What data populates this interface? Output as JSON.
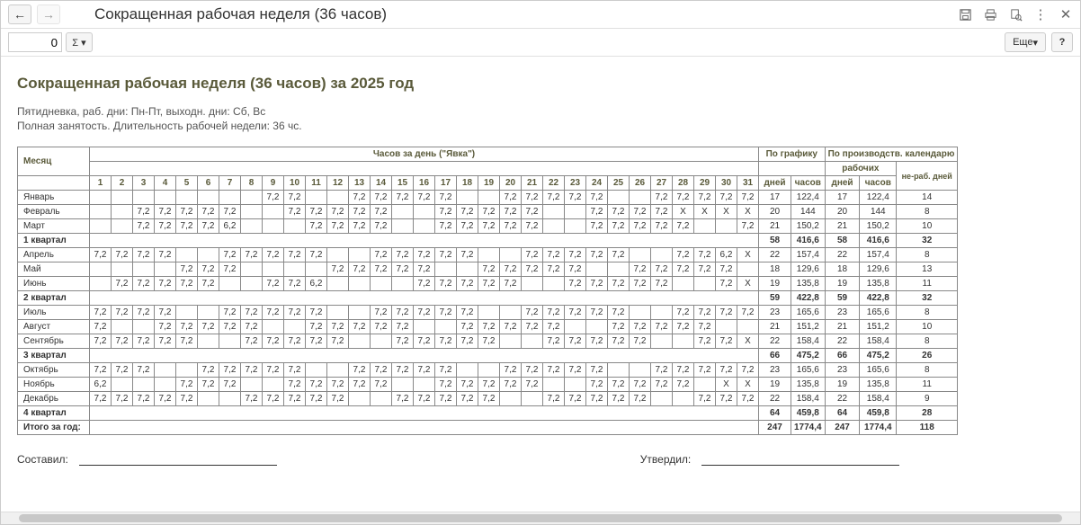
{
  "header": {
    "title": "Сокращенная рабочая неделя (36 часов)"
  },
  "toolbar": {
    "page_number": "0",
    "more_label": "Еще",
    "help_label": "?"
  },
  "report": {
    "title": "Сокращенная рабочая неделя (36 часов) за 2025 год",
    "line1": "Пятидневка, раб. дни: Пн-Пт, выходн. дни: Сб, Вс",
    "line2": "Полная занятость. Длительность рабочей недели: 36 чс."
  },
  "headers": {
    "month": "Месяц",
    "hours_per_day": "Часов за день (\"Явка\")",
    "by_schedule": "По графику",
    "by_calendar": "По производств. календарю",
    "work_short": "рабочих",
    "nonwork_short": "не-раб. дней",
    "days": "дней",
    "hours": "часов"
  },
  "day_nums": [
    "1",
    "2",
    "3",
    "4",
    "5",
    "6",
    "7",
    "8",
    "9",
    "10",
    "11",
    "12",
    "13",
    "14",
    "15",
    "16",
    "17",
    "18",
    "19",
    "20",
    "21",
    "22",
    "23",
    "24",
    "25",
    "26",
    "27",
    "28",
    "29",
    "30",
    "31"
  ],
  "rows": [
    {
      "type": "month",
      "name": "Январь",
      "days": [
        "",
        "",
        "",
        "",
        "",
        "",
        "",
        "",
        "7,2",
        "7,2",
        "",
        "",
        "7,2",
        "7,2",
        "7,2",
        "7,2",
        "7,2",
        "",
        "",
        "7,2",
        "7,2",
        "7,2",
        "7,2",
        "7,2",
        "",
        "",
        "7,2",
        "7,2",
        "7,2",
        "7,2",
        "7,2"
      ],
      "s_days": "17",
      "s_hours": "122,4",
      "c_days": "17",
      "c_hours": "122,4",
      "c_off": "14"
    },
    {
      "type": "month",
      "name": "Февраль",
      "days": [
        "",
        "",
        "7,2",
        "7,2",
        "7,2",
        "7,2",
        "7,2",
        "",
        "",
        "7,2",
        "7,2",
        "7,2",
        "7,2",
        "7,2",
        "",
        "",
        "7,2",
        "7,2",
        "7,2",
        "7,2",
        "7,2",
        "",
        "",
        "7,2",
        "7,2",
        "7,2",
        "7,2",
        "X",
        "X",
        "X",
        "X"
      ],
      "s_days": "20",
      "s_hours": "144",
      "c_days": "20",
      "c_hours": "144",
      "c_off": "8"
    },
    {
      "type": "month",
      "name": "Март",
      "days": [
        "",
        "",
        "7,2",
        "7,2",
        "7,2",
        "7,2",
        "6,2",
        "",
        "",
        "",
        "7,2",
        "7,2",
        "7,2",
        "7,2",
        "",
        "",
        "7,2",
        "7,2",
        "7,2",
        "7,2",
        "7,2",
        "",
        "",
        "7,2",
        "7,2",
        "7,2",
        "7,2",
        "7,2",
        "",
        "",
        "7,2"
      ],
      "s_days": "21",
      "s_hours": "150,2",
      "c_days": "21",
      "c_hours": "150,2",
      "c_off": "10"
    },
    {
      "type": "quarter",
      "name": "1 квартал",
      "s_days": "58",
      "s_hours": "416,6",
      "c_days": "58",
      "c_hours": "416,6",
      "c_off": "32"
    },
    {
      "type": "month",
      "name": "Апрель",
      "days": [
        "7,2",
        "7,2",
        "7,2",
        "7,2",
        "",
        "",
        "7,2",
        "7,2",
        "7,2",
        "7,2",
        "7,2",
        "",
        "",
        "7,2",
        "7,2",
        "7,2",
        "7,2",
        "7,2",
        "",
        "",
        "7,2",
        "7,2",
        "7,2",
        "7,2",
        "7,2",
        "",
        "",
        "7,2",
        "7,2",
        "6,2",
        "X"
      ],
      "s_days": "22",
      "s_hours": "157,4",
      "c_days": "22",
      "c_hours": "157,4",
      "c_off": "8"
    },
    {
      "type": "month",
      "name": "Май",
      "days": [
        "",
        "",
        "",
        "",
        "7,2",
        "7,2",
        "7,2",
        "",
        "",
        "",
        "",
        "7,2",
        "7,2",
        "7,2",
        "7,2",
        "7,2",
        "",
        "",
        "7,2",
        "7,2",
        "7,2",
        "7,2",
        "7,2",
        "",
        "",
        "7,2",
        "7,2",
        "7,2",
        "7,2",
        "7,2",
        ""
      ],
      "s_days": "18",
      "s_hours": "129,6",
      "c_days": "18",
      "c_hours": "129,6",
      "c_off": "13"
    },
    {
      "type": "month",
      "name": "Июнь",
      "days": [
        "",
        "7,2",
        "7,2",
        "7,2",
        "7,2",
        "7,2",
        "",
        "",
        "7,2",
        "7,2",
        "6,2",
        "",
        "",
        "",
        "",
        "7,2",
        "7,2",
        "7,2",
        "7,2",
        "7,2",
        "",
        "",
        "7,2",
        "7,2",
        "7,2",
        "7,2",
        "7,2",
        "",
        "",
        "7,2",
        "X"
      ],
      "s_days": "19",
      "s_hours": "135,8",
      "c_days": "19",
      "c_hours": "135,8",
      "c_off": "11"
    },
    {
      "type": "quarter",
      "name": "2 квартал",
      "s_days": "59",
      "s_hours": "422,8",
      "c_days": "59",
      "c_hours": "422,8",
      "c_off": "32"
    },
    {
      "type": "month",
      "name": "Июль",
      "days": [
        "7,2",
        "7,2",
        "7,2",
        "7,2",
        "",
        "",
        "7,2",
        "7,2",
        "7,2",
        "7,2",
        "7,2",
        "",
        "",
        "7,2",
        "7,2",
        "7,2",
        "7,2",
        "7,2",
        "",
        "",
        "7,2",
        "7,2",
        "7,2",
        "7,2",
        "7,2",
        "",
        "",
        "7,2",
        "7,2",
        "7,2",
        "7,2"
      ],
      "s_days": "23",
      "s_hours": "165,6",
      "c_days": "23",
      "c_hours": "165,6",
      "c_off": "8"
    },
    {
      "type": "month",
      "name": "Август",
      "days": [
        "7,2",
        "",
        "",
        "7,2",
        "7,2",
        "7,2",
        "7,2",
        "7,2",
        "",
        "",
        "7,2",
        "7,2",
        "7,2",
        "7,2",
        "7,2",
        "",
        "",
        "7,2",
        "7,2",
        "7,2",
        "7,2",
        "7,2",
        "",
        "",
        "7,2",
        "7,2",
        "7,2",
        "7,2",
        "7,2",
        "",
        ""
      ],
      "s_days": "21",
      "s_hours": "151,2",
      "c_days": "21",
      "c_hours": "151,2",
      "c_off": "10"
    },
    {
      "type": "month",
      "name": "Сентябрь",
      "days": [
        "7,2",
        "7,2",
        "7,2",
        "7,2",
        "7,2",
        "",
        "",
        "7,2",
        "7,2",
        "7,2",
        "7,2",
        "7,2",
        "",
        "",
        "7,2",
        "7,2",
        "7,2",
        "7,2",
        "7,2",
        "",
        "",
        "7,2",
        "7,2",
        "7,2",
        "7,2",
        "7,2",
        "",
        "",
        "7,2",
        "7,2",
        "X"
      ],
      "s_days": "22",
      "s_hours": "158,4",
      "c_days": "22",
      "c_hours": "158,4",
      "c_off": "8"
    },
    {
      "type": "quarter",
      "name": "3 квартал",
      "s_days": "66",
      "s_hours": "475,2",
      "c_days": "66",
      "c_hours": "475,2",
      "c_off": "26"
    },
    {
      "type": "month",
      "name": "Октябрь",
      "days": [
        "7,2",
        "7,2",
        "7,2",
        "",
        "",
        "7,2",
        "7,2",
        "7,2",
        "7,2",
        "7,2",
        "",
        "",
        "7,2",
        "7,2",
        "7,2",
        "7,2",
        "7,2",
        "",
        "",
        "7,2",
        "7,2",
        "7,2",
        "7,2",
        "7,2",
        "",
        "",
        "7,2",
        "7,2",
        "7,2",
        "7,2",
        "7,2"
      ],
      "s_days": "23",
      "s_hours": "165,6",
      "c_days": "23",
      "c_hours": "165,6",
      "c_off": "8"
    },
    {
      "type": "month",
      "name": "Ноябрь",
      "days": [
        "6,2",
        "",
        "",
        "",
        "7,2",
        "7,2",
        "7,2",
        "",
        "",
        "7,2",
        "7,2",
        "7,2",
        "7,2",
        "7,2",
        "",
        "",
        "7,2",
        "7,2",
        "7,2",
        "7,2",
        "7,2",
        "",
        "",
        "7,2",
        "7,2",
        "7,2",
        "7,2",
        "7,2",
        "",
        "X",
        "X"
      ],
      "s_days": "19",
      "s_hours": "135,8",
      "c_days": "19",
      "c_hours": "135,8",
      "c_off": "11"
    },
    {
      "type": "month",
      "name": "Декабрь",
      "days": [
        "7,2",
        "7,2",
        "7,2",
        "7,2",
        "7,2",
        "",
        "",
        "7,2",
        "7,2",
        "7,2",
        "7,2",
        "7,2",
        "",
        "",
        "7,2",
        "7,2",
        "7,2",
        "7,2",
        "7,2",
        "",
        "",
        "7,2",
        "7,2",
        "7,2",
        "7,2",
        "7,2",
        "",
        "",
        "7,2",
        "7,2",
        "7,2"
      ],
      "s_days": "22",
      "s_hours": "158,4",
      "c_days": "22",
      "c_hours": "158,4",
      "c_off": "9"
    },
    {
      "type": "quarter",
      "name": "4 квартал",
      "s_days": "64",
      "s_hours": "459,8",
      "c_days": "64",
      "c_hours": "459,8",
      "c_off": "28"
    },
    {
      "type": "total",
      "name": "Итого за год:",
      "s_days": "247",
      "s_hours": "1774,4",
      "c_days": "247",
      "c_hours": "1774,4",
      "c_off": "118"
    }
  ],
  "signatures": {
    "made_by": "Составил:",
    "approved_by": "Утвердил:"
  }
}
